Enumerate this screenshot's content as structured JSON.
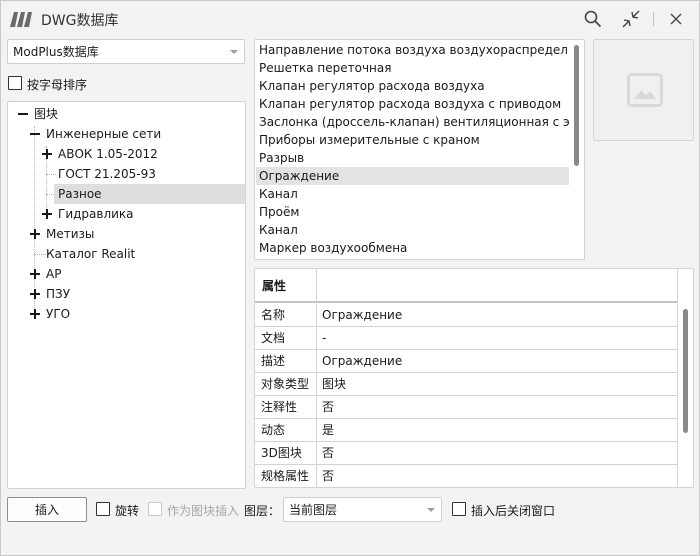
{
  "window": {
    "title": "DWG数据库"
  },
  "library_select": {
    "value": "ModPlus数据库"
  },
  "sort_alpha": {
    "label": "按字母排序",
    "checked": false
  },
  "tree": [
    {
      "label": "图块",
      "level": 0,
      "expander": "minus"
    },
    {
      "label": "Инженерные сети",
      "level": 1,
      "expander": "minus"
    },
    {
      "label": "АВОК 1.05-2012",
      "level": 2,
      "expander": "plus"
    },
    {
      "label": "ГОСТ 21.205-93",
      "level": 2,
      "expander": "none"
    },
    {
      "label": "Разное",
      "level": 2,
      "expander": "none",
      "selected": true
    },
    {
      "label": "Гидравлика",
      "level": 2,
      "expander": "plus"
    },
    {
      "label": "Метизы",
      "level": 1,
      "expander": "plus"
    },
    {
      "label": "Каталог Realit",
      "level": 1,
      "expander": "none"
    },
    {
      "label": "АР",
      "level": 1,
      "expander": "plus"
    },
    {
      "label": "ПЗУ",
      "level": 1,
      "expander": "plus"
    },
    {
      "label": "УГО",
      "level": 1,
      "expander": "plus"
    }
  ],
  "blocks": [
    "Направление потока воздуха воздухораспределителя",
    "Решетка переточная",
    "Клапан регулятор расхода воздуха",
    "Клапан регулятор расхода воздуха с приводом",
    "Заслонка (дроссель-клапан) вентиляционная с электрог",
    "Приборы измерительные с краном",
    "Разрыв",
    "Ограждение",
    "Канал",
    "Проём",
    "Канал",
    "Маркер воздухообмена"
  ],
  "blocks_selected_index": 7,
  "preview": {
    "icon": "image-placeholder-icon"
  },
  "properties": {
    "header": "属性",
    "rows": [
      {
        "key": "名称",
        "value": "Ограждение"
      },
      {
        "key": "文档",
        "value": "-"
      },
      {
        "key": "描述",
        "value": "Ограждение"
      },
      {
        "key": "对象类型",
        "value": "图块"
      },
      {
        "key": "注释性",
        "value": "否"
      },
      {
        "key": "动态",
        "value": "是"
      },
      {
        "key": "3D图块",
        "value": "否"
      },
      {
        "key": "规格属性",
        "value": "否"
      }
    ]
  },
  "bottom": {
    "insert_label": "插入",
    "rotate_label": "旋转",
    "insert_as_block_label": "作为图块插入",
    "layer_label": "图层：",
    "layer_value": "当前图层",
    "close_after_label": "插入后关闭窗口"
  },
  "colors": {
    "selection": "#dedede",
    "accent": "#5a5a5a"
  }
}
